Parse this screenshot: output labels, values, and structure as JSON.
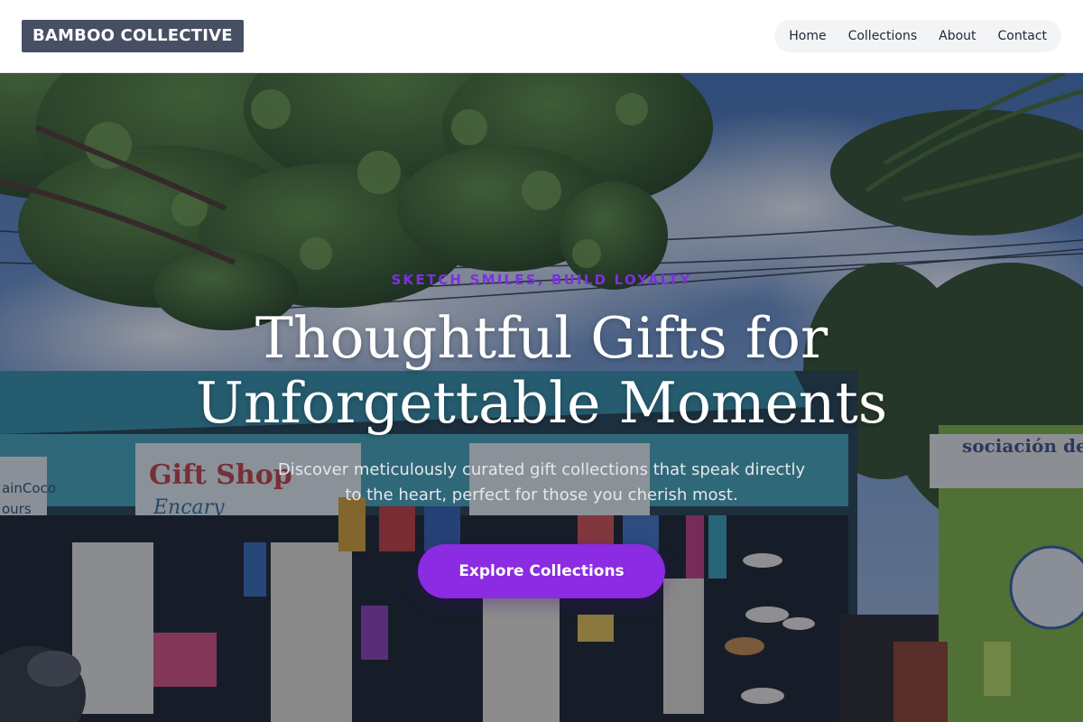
{
  "header": {
    "brand": "BAMBOO COLLECTIVE",
    "nav": [
      "Home",
      "Collections",
      "About",
      "Contact"
    ]
  },
  "hero": {
    "eyebrow": "SKETCH SMILES, BUILD LOYALTY",
    "headline_line1": "Thoughtful Gifts for",
    "headline_line2": "Unforgettable Moments",
    "subtext_line1": "Discover meticulously curated gift collections that speak directly",
    "subtext_line2": "to the heart, perfect for those you cherish most.",
    "cta_label": "Explore Collections",
    "background_description": "gift-shop-storefront-photo",
    "sign_texts": {
      "left_sign": "Gift Shop",
      "left_sign_sub": "Encary",
      "left_edge_sign_1": "ainCoco",
      "left_edge_sign_2": "ours",
      "right_sign": "sociación de tr"
    }
  },
  "colors": {
    "brand_bg": "#475063",
    "accent": "#8b2be2",
    "eyebrow": "#7c2fe0",
    "nav_pill_bg": "#f3f4f6",
    "overlay": "rgba(28,32,48,0.46)"
  }
}
